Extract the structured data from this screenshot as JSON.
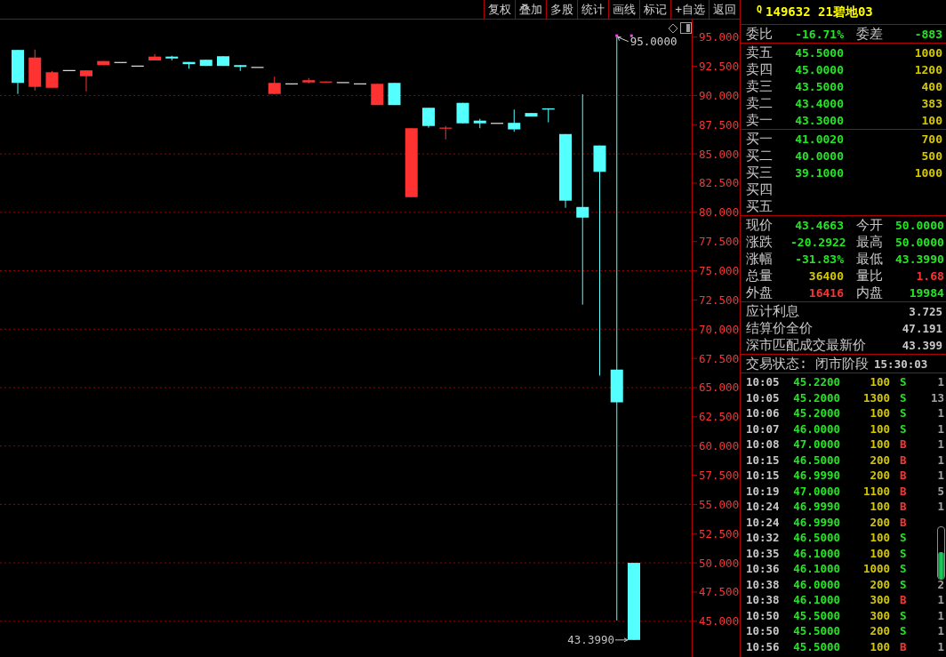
{
  "toolbar": {
    "buttons": [
      "复权",
      "叠加",
      "多股",
      "统计",
      "画线",
      "标记",
      "+自选",
      "返回"
    ]
  },
  "chart": {
    "chart_data": {
      "type": "candlestick",
      "ylim": [
        42.2,
        96.5
      ],
      "yticks": [
        {
          "value": 95,
          "label": "95.000"
        },
        {
          "value": 92.5,
          "label": "92.500"
        },
        {
          "value": 90,
          "label": "90.000"
        },
        {
          "value": 87.5,
          "label": "87.500"
        },
        {
          "value": 85,
          "label": "85.000"
        },
        {
          "value": 82.5,
          "label": "82.500"
        },
        {
          "value": 80,
          "label": "80.000"
        },
        {
          "value": 77.5,
          "label": "77.500"
        },
        {
          "value": 75,
          "label": "75.000"
        },
        {
          "value": 72.5,
          "label": "72.500"
        },
        {
          "value": 70,
          "label": "70.000"
        },
        {
          "value": 67.5,
          "label": "67.500"
        },
        {
          "value": 65,
          "label": "65.000"
        },
        {
          "value": 62.5,
          "label": "62.500"
        },
        {
          "value": 60,
          "label": "60.000"
        },
        {
          "value": 57.5,
          "label": "57.500"
        },
        {
          "value": 55,
          "label": "55.000"
        },
        {
          "value": 52.5,
          "label": "52.500"
        },
        {
          "value": 50,
          "label": "50.000"
        },
        {
          "value": 47.5,
          "label": "47.500"
        },
        {
          "value": 45,
          "label": "45.000"
        }
      ],
      "grid": true,
      "ohlc": [
        [
          93.9,
          93.9,
          90.13,
          91.08
        ],
        [
          90.74,
          93.93,
          90.43,
          93.25
        ],
        [
          90.66,
          92.1,
          90.66,
          91.99
        ],
        [
          92.18,
          92.18,
          92.18,
          92.18
        ],
        [
          91.65,
          92.15,
          90.36,
          92.15
        ],
        [
          92.6,
          92.95,
          92.6,
          92.95
        ],
        [
          92.87,
          92.87,
          92.87,
          92.87
        ],
        [
          92.56,
          92.56,
          92.56,
          92.56
        ],
        [
          93.0,
          93.55,
          93.0,
          93.33
        ],
        [
          93.33,
          93.4,
          93.0,
          93.17
        ],
        [
          92.87,
          92.87,
          92.3,
          92.68
        ],
        [
          93.06,
          93.06,
          92.53,
          92.53
        ],
        [
          93.36,
          93.36,
          92.53,
          92.53
        ],
        [
          92.6,
          92.6,
          92.1,
          92.45
        ],
        [
          92.45,
          92.45,
          92.45,
          92.45
        ],
        [
          90.13,
          91.61,
          90.13,
          91.08
        ],
        [
          91.04,
          91.04,
          91.04,
          91.04
        ],
        [
          91.12,
          91.5,
          91.04,
          91.31
        ],
        [
          91.12,
          91.2,
          91.12,
          91.2
        ],
        [
          91.15,
          91.15,
          91.15,
          91.15
        ],
        [
          91.04,
          91.04,
          91.04,
          91.04
        ],
        [
          89.18,
          91.0,
          89.18,
          91.0
        ],
        [
          91.08,
          91.08,
          89.18,
          89.18
        ],
        [
          81.3,
          87.2,
          81.3,
          87.2
        ],
        [
          88.95,
          88.95,
          87.24,
          87.39
        ],
        [
          87.2,
          87.39,
          86.25,
          87.25
        ],
        [
          89.37,
          89.37,
          87.62,
          87.62
        ],
        [
          87.85,
          88.0,
          87.2,
          87.62
        ],
        [
          87.66,
          87.66,
          87.66,
          87.66
        ],
        [
          87.66,
          88.8,
          86.9,
          87.1
        ],
        [
          88.5,
          88.5,
          88.2,
          88.2
        ],
        [
          88.9,
          88.9,
          87.7,
          88.8
        ],
        [
          86.7,
          86.7,
          80.39,
          81.0
        ],
        [
          80.46,
          90.1,
          72.1,
          79.55
        ],
        [
          85.72,
          85.72,
          66.03,
          83.47
        ],
        [
          66.54,
          95.0,
          45.07,
          63.74
        ],
        [
          50.0,
          50.0,
          43.4,
          43.4
        ]
      ]
    },
    "high_label": "95.0000",
    "low_label": "43.3990"
  },
  "quote": {
    "marker": "Q",
    "title": "149632 21碧地03"
  },
  "ratio": [
    {
      "label": "委比",
      "value": "-16.71%",
      "color": "#22e622"
    },
    {
      "label": "委差",
      "value": "-883",
      "color": "#22e622"
    }
  ],
  "asks": [
    {
      "label": "卖五",
      "price": "45.5000",
      "volume": "1000"
    },
    {
      "label": "卖四",
      "price": "45.0000",
      "volume": "1200"
    },
    {
      "label": "卖三",
      "price": "43.5000",
      "volume": "400"
    },
    {
      "label": "卖二",
      "price": "43.4000",
      "volume": "383"
    },
    {
      "label": "卖一",
      "price": "43.3000",
      "volume": "100"
    }
  ],
  "bids": [
    {
      "label": "买一",
      "price": "41.0020",
      "volume": "700"
    },
    {
      "label": "买二",
      "price": "40.0000",
      "volume": "500"
    },
    {
      "label": "买三",
      "price": "39.1000",
      "volume": "1000"
    },
    {
      "label": "买四"
    },
    {
      "label": "买五"
    }
  ],
  "stats": [
    {
      "label": "现价",
      "value": "43.4663",
      "color": "#22e622"
    },
    {
      "label": "今开",
      "value": "50.0000",
      "color": "#22e622"
    },
    {
      "label": "涨跌",
      "value": "-20.2922",
      "color": "#22e622"
    },
    {
      "label": "最高",
      "value": "50.0000",
      "color": "#22e622"
    },
    {
      "label": "涨幅",
      "value": "-31.83%",
      "color": "#22e622"
    },
    {
      "label": "最低",
      "value": "43.3990",
      "color": "#22e622"
    },
    {
      "label": "总量",
      "value": "36400",
      "color": "#d4c800"
    },
    {
      "label": "量比",
      "value": "1.68",
      "color": "#ff3232"
    },
    {
      "label": "外盘",
      "value": "16416",
      "color": "#ff3232"
    },
    {
      "label": "内盘",
      "value": "19984",
      "color": "#22e622"
    }
  ],
  "info": [
    {
      "label": "应计利息",
      "value": "3.725"
    },
    {
      "label": "结算价全价",
      "value": "47.191"
    },
    {
      "label": "深市匹配成交最新价",
      "value": "43.399"
    }
  ],
  "status": {
    "label": "交易状态: 闭市阶段",
    "time": "15:30:03"
  },
  "trades": [
    {
      "time": "10:05",
      "price": "45.2200",
      "volume": "100",
      "side": "S",
      "color": "#22e622",
      "count": "1"
    },
    {
      "time": "10:05",
      "price": "45.2000",
      "volume": "1300",
      "side": "S",
      "color": "#22e622",
      "count": "13"
    },
    {
      "time": "10:06",
      "price": "45.2000",
      "volume": "100",
      "side": "S",
      "color": "#22e622",
      "count": "1"
    },
    {
      "time": "10:07",
      "price": "46.0000",
      "volume": "100",
      "side": "S",
      "color": "#22e622",
      "count": "1"
    },
    {
      "time": "10:08",
      "price": "47.0000",
      "volume": "100",
      "side": "B",
      "color": "#ff3232",
      "count": "1"
    },
    {
      "time": "10:15",
      "price": "46.5000",
      "volume": "200",
      "side": "B",
      "color": "#ff3232",
      "count": "1"
    },
    {
      "time": "10:15",
      "price": "46.9990",
      "volume": "200",
      "side": "B",
      "color": "#ff3232",
      "count": "1"
    },
    {
      "time": "10:19",
      "price": "47.0000",
      "volume": "1100",
      "side": "B",
      "color": "#ff3232",
      "count": "5"
    },
    {
      "time": "10:24",
      "price": "46.9990",
      "volume": "100",
      "side": "B",
      "color": "#ff3232",
      "count": "1"
    },
    {
      "time": "10:24",
      "price": "46.9990",
      "volume": "200",
      "side": "B",
      "color": "#ff3232"
    },
    {
      "time": "10:32",
      "price": "46.5000",
      "volume": "100",
      "side": "S",
      "color": "#22e622"
    },
    {
      "time": "10:35",
      "price": "46.1000",
      "volume": "100",
      "side": "S",
      "color": "#22e622"
    },
    {
      "time": "10:36",
      "price": "46.1000",
      "volume": "1000",
      "side": "S",
      "color": "#22e622"
    },
    {
      "time": "10:38",
      "price": "46.0000",
      "volume": "200",
      "side": "S",
      "color": "#22e622",
      "count": "2"
    },
    {
      "time": "10:38",
      "price": "46.1000",
      "volume": "300",
      "side": "B",
      "color": "#ff3232",
      "count": "1"
    },
    {
      "time": "10:50",
      "price": "45.5000",
      "volume": "300",
      "side": "S",
      "color": "#22e622",
      "count": "1"
    },
    {
      "time": "10:50",
      "price": "45.5000",
      "volume": "200",
      "side": "S",
      "color": "#22e622",
      "count": "1"
    },
    {
      "time": "10:56",
      "price": "45.5000",
      "volume": "100",
      "side": "B",
      "color": "#ff3232",
      "count": "1"
    }
  ]
}
